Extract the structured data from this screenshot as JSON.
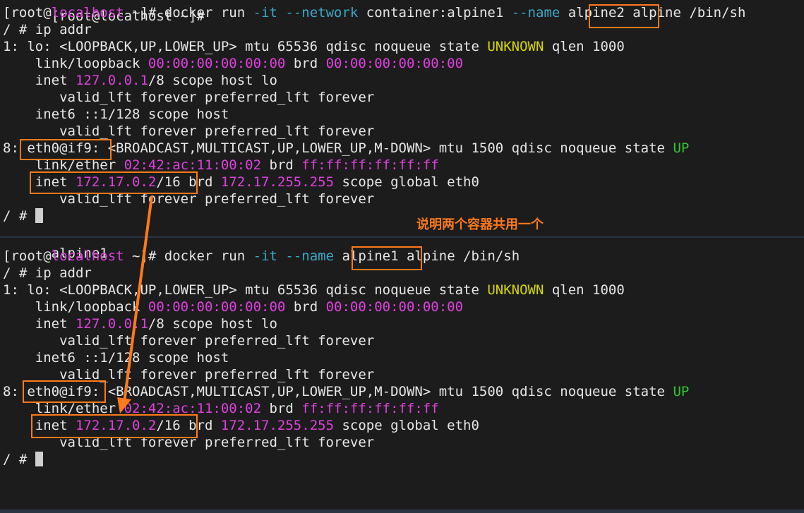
{
  "colors": {
    "background": "#1c1c1c",
    "text": "#e6e6e6",
    "magenta": "#e040e0",
    "cyan": "#38a8c8",
    "yellow": "#d6d600",
    "green": "#2ec82e",
    "highlight": "#ff7a1a"
  },
  "annotation": {
    "note": "说明两个容器共用一个"
  },
  "top_pane": {
    "partial_line": "[root@localhost ~]#",
    "lines": [
      [
        {
          "t": "[root@",
          "c": "n"
        },
        {
          "t": "localhost",
          "c": "m"
        },
        {
          "t": " ~]# docker run ",
          "c": "n"
        },
        {
          "t": "-it",
          "c": "c"
        },
        {
          "t": " ",
          "c": "n"
        },
        {
          "t": "--network",
          "c": "c"
        },
        {
          "t": " container:alpine1 ",
          "c": "n"
        },
        {
          "t": "--name",
          "c": "c"
        },
        {
          "t": " alpine2 alpine /bin/sh",
          "c": "n"
        }
      ],
      [
        {
          "t": "/ # ip addr",
          "c": "n"
        }
      ],
      [
        {
          "t": "1: lo: <LOOPBACK,UP,LOWER_UP> mtu 65536 qdisc noqueue state ",
          "c": "n"
        },
        {
          "t": "UNKNOWN",
          "c": "y"
        },
        {
          "t": " qlen 1000",
          "c": "n"
        }
      ],
      [
        {
          "t": "    link/loopback ",
          "c": "n"
        },
        {
          "t": "00:00:00:00:00:00",
          "c": "m"
        },
        {
          "t": " brd ",
          "c": "n"
        },
        {
          "t": "00:00:00:00:00:00",
          "c": "m"
        }
      ],
      [
        {
          "t": "    inet ",
          "c": "n"
        },
        {
          "t": "127.0.0.1",
          "c": "m"
        },
        {
          "t": "/8 scope host lo",
          "c": "n"
        }
      ],
      [
        {
          "t": "       valid_lft forever preferred_lft forever",
          "c": "n"
        }
      ],
      [
        {
          "t": "    inet6 ::1/128 scope host",
          "c": "n"
        }
      ],
      [
        {
          "t": "       valid_lft forever preferred_lft forever",
          "c": "n"
        }
      ],
      [
        {
          "t": "8: eth0@if9: <BROADCAST,MULTICAST,UP,LOWER_UP,M-DOWN> mtu 1500 qdisc noqueue state ",
          "c": "n"
        },
        {
          "t": "UP",
          "c": "g"
        }
      ],
      [
        {
          "t": "    link/ether ",
          "c": "n"
        },
        {
          "t": "02:42:ac:11:00:02",
          "c": "m"
        },
        {
          "t": " brd ",
          "c": "n"
        },
        {
          "t": "ff:ff:ff:ff:ff:ff",
          "c": "m"
        }
      ],
      [
        {
          "t": "    inet ",
          "c": "n"
        },
        {
          "t": "172.17.0.2",
          "c": "m"
        },
        {
          "t": "/16 brd ",
          "c": "n"
        },
        {
          "t": "172.17.255.255",
          "c": "m"
        },
        {
          "t": " scope global eth0",
          "c": "n"
        }
      ],
      [
        {
          "t": "       valid_lft forever preferred_lft forever",
          "c": "n"
        }
      ],
      [
        {
          "t": "/ # ",
          "c": "n"
        }
      ]
    ]
  },
  "bottom_pane": {
    "partial_line": "alpine1",
    "lines": [
      [
        {
          "t": "[root@",
          "c": "n"
        },
        {
          "t": "localhost",
          "c": "m"
        },
        {
          "t": " ~]# docker run ",
          "c": "n"
        },
        {
          "t": "-it",
          "c": "c"
        },
        {
          "t": " ",
          "c": "n"
        },
        {
          "t": "--name",
          "c": "c"
        },
        {
          "t": " alpine1 alpine /bin/sh",
          "c": "n"
        }
      ],
      [
        {
          "t": "/ # ip addr",
          "c": "n"
        }
      ],
      [
        {
          "t": "1: lo: <LOOPBACK,UP,LOWER_UP> mtu 65536 qdisc noqueue state ",
          "c": "n"
        },
        {
          "t": "UNKNOWN",
          "c": "y"
        },
        {
          "t": " qlen 1000",
          "c": "n"
        }
      ],
      [
        {
          "t": "    link/loopback ",
          "c": "n"
        },
        {
          "t": "00:00:00:00:00:00",
          "c": "m"
        },
        {
          "t": " brd ",
          "c": "n"
        },
        {
          "t": "00:00:00:00:00:00",
          "c": "m"
        }
      ],
      [
        {
          "t": "    inet ",
          "c": "n"
        },
        {
          "t": "127.0.0.1",
          "c": "m"
        },
        {
          "t": "/8 scope host lo",
          "c": "n"
        }
      ],
      [
        {
          "t": "       valid_lft forever preferred_lft forever",
          "c": "n"
        }
      ],
      [
        {
          "t": "    inet6 ::1/128 scope host",
          "c": "n"
        }
      ],
      [
        {
          "t": "       valid_lft forever preferred_lft forever",
          "c": "n"
        }
      ],
      [
        {
          "t": "8: eth0@if9: <BROADCAST,MULTICAST,UP,LOWER_UP,M-DOWN> mtu 1500 qdisc noqueue state ",
          "c": "n"
        },
        {
          "t": "UP",
          "c": "g"
        }
      ],
      [
        {
          "t": "    link/ether ",
          "c": "n"
        },
        {
          "t": "02:42:ac:11:00:02",
          "c": "m"
        },
        {
          "t": " brd ",
          "c": "n"
        },
        {
          "t": "ff:ff:ff:ff:ff:ff",
          "c": "m"
        }
      ],
      [
        {
          "t": "    inet ",
          "c": "n"
        },
        {
          "t": "172.17.0.2",
          "c": "m"
        },
        {
          "t": "/16 brd ",
          "c": "n"
        },
        {
          "t": "172.17.255.255",
          "c": "m"
        },
        {
          "t": " scope global eth0",
          "c": "n"
        }
      ],
      [
        {
          "t": "       valid_lft forever preferred_lft forever",
          "c": "n"
        }
      ],
      [
        {
          "t": "/ # ",
          "c": "n"
        }
      ]
    ]
  }
}
